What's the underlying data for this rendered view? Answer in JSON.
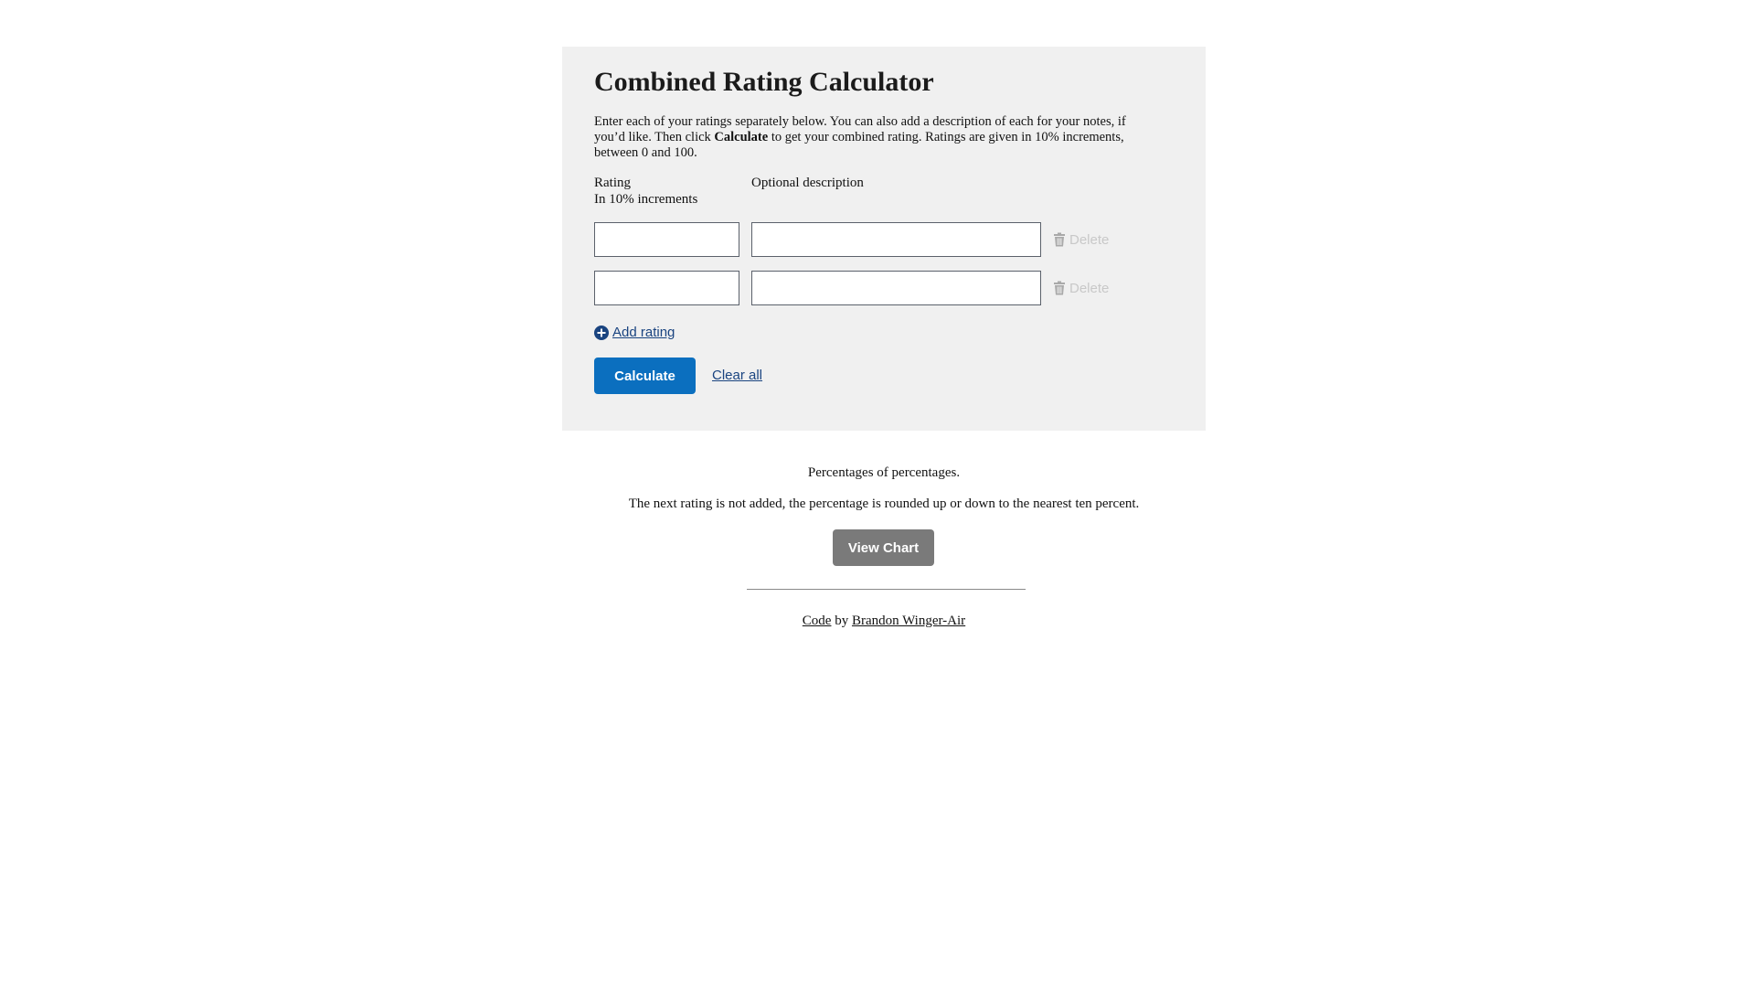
{
  "calculator": {
    "title": "Combined Rating Calculator",
    "intro_part1": "Enter each of your ratings separately below. You can also add a description of each for your notes, if you’d like. Then click ",
    "intro_bold": "Calculate",
    "intro_part2": " to get your combined rating. Ratings are given in 10% increments, between 0 and 100.",
    "col_rating_label": "Rating",
    "col_rating_hint": "In 10% increments",
    "col_description_label": "Optional description",
    "rows": [
      {
        "rating_value": "",
        "description_value": "",
        "delete_label": "Delete"
      },
      {
        "rating_value": "",
        "description_value": "",
        "delete_label": "Delete"
      }
    ],
    "add_rating_label": "Add rating",
    "calculate_label": "Calculate",
    "clear_all_label": "Clear all"
  },
  "notes": {
    "line1": "Percentages of percentages.",
    "line2": "The next rating is not added, the percentage is rounded up or down to the nearest ten percent.",
    "view_chart_label": "View Chart"
  },
  "credits": {
    "code_link": "Code",
    "by_text": " by ",
    "author_link": "Brandon Winger-Air"
  },
  "colors": {
    "primary_button": "#0b6fbf",
    "secondary_button": "#7a7a7a",
    "panel_background": "#f0f0f0",
    "link": "#1a4480",
    "delete_disabled": "#c8c8c8"
  },
  "icons": {
    "delete": "trash-icon",
    "add": "plus-circle-icon"
  }
}
